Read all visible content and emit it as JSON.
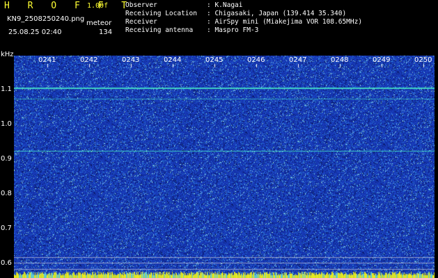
{
  "header": {
    "brand": "H R O F F T",
    "version": "1.00f",
    "filename": "KN9_2508250240.png",
    "type": "meteor",
    "datetime": "25.08.25 02:40",
    "count": "134"
  },
  "meta": [
    {
      "label": "Observer",
      "value": ": K.Nagai"
    },
    {
      "label": "Receiving Location",
      "value": ": Chigasaki, Japan (139.414 35.340)"
    },
    {
      "label": "Receiver",
      "value": ": AirSpy mini (Miakejima VOR 108.65MHz)"
    },
    {
      "label": "Receiving antenna",
      "value": ": Maspro FM-3"
    }
  ],
  "axis": {
    "y_unit": "kHz",
    "y_ticks": [
      "1.1",
      "1.0",
      "0.9",
      "0.8",
      "0.7",
      "0.6"
    ],
    "x_ticks": [
      "0241",
      "0242",
      "0243",
      "0244",
      "0245",
      "0246",
      "0247",
      "0248",
      "0249",
      "0250"
    ]
  },
  "colors": {
    "background": "#000000",
    "noise_base": "#1e3ab8",
    "carrier_line": "#40e8c8",
    "header_yellow": "#ffff33"
  }
}
